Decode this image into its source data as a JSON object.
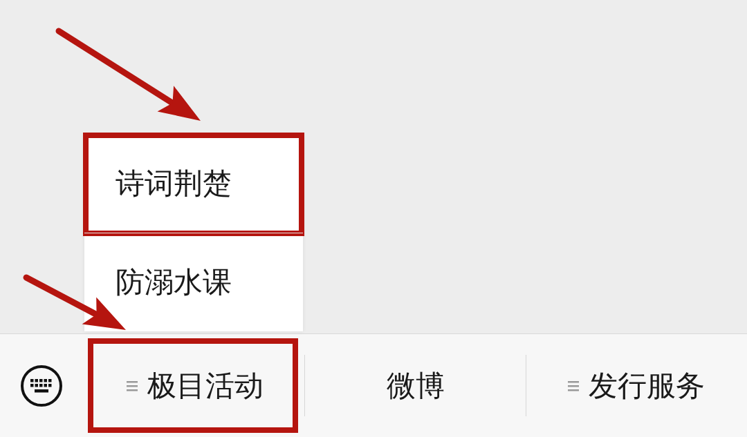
{
  "popup_menu": {
    "items": [
      {
        "label": "诗词荆楚",
        "highlighted": true
      },
      {
        "label": "防溺水课",
        "highlighted": false
      }
    ]
  },
  "bottom_menu": {
    "items": [
      {
        "label": "极目活动",
        "kind": "submenu",
        "highlighted": true,
        "expanded": true
      },
      {
        "label": "微博",
        "kind": "link",
        "highlighted": false,
        "expanded": false
      },
      {
        "label": "发行服务",
        "kind": "submenu",
        "highlighted": false,
        "expanded": false
      }
    ]
  }
}
